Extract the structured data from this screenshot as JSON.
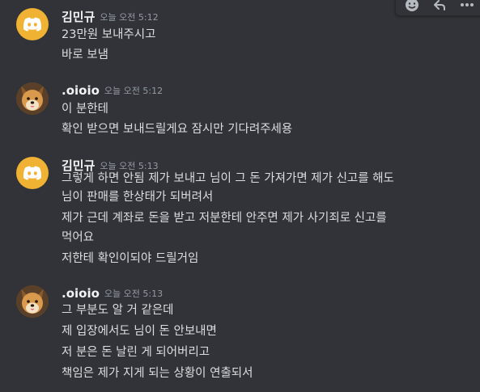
{
  "toolbar": {
    "icons": [
      "add-reaction-icon",
      "reply-icon",
      "more-options-icon"
    ]
  },
  "colors": {
    "background": "#313338",
    "username": "#f2f3f5",
    "text": "#dbdee1",
    "timestamp": "#949ba4",
    "discord_avatar": "#f0b232"
  },
  "messages": [
    {
      "username": "김민규",
      "timestamp": "오늘 오전 5:12",
      "avatar": "discord-default-avatar",
      "lines": [
        "23만원 보내주시고",
        "바로 보냄"
      ]
    },
    {
      "username": ".oioio",
      "timestamp": "오늘 오전 5:12",
      "avatar": "dog-avatar",
      "lines": [
        "이 분한테",
        "확인 받으면 보내드릴게요 잠시만 기다려주세용"
      ]
    },
    {
      "username": "김민규",
      "timestamp": "오늘 오전 5:13",
      "avatar": "discord-default-avatar",
      "lines": [
        "그렇게 하면 안됨 제가 보내고 님이 그 돈 가져가면 제가 신고를 해도",
        "님이 판매를 한상태가 되버려서",
        "제가 근데 계좌로 돈을 받고 저분한테 안주면 제가 사기죄로 신고를",
        "먹어요",
        "저한테 확인이되야 드릴거임"
      ]
    },
    {
      "username": ".oioio",
      "timestamp": "오늘 오전 5:13",
      "avatar": "dog-avatar",
      "lines": [
        "그 부분도 알 거 같은데",
        "제 입장에서도 님이 돈 안보내면",
        "저 분은 돈 날린 게 되어버리고",
        "책임은 제가 지게 되는 상황이 연출되서"
      ]
    }
  ]
}
